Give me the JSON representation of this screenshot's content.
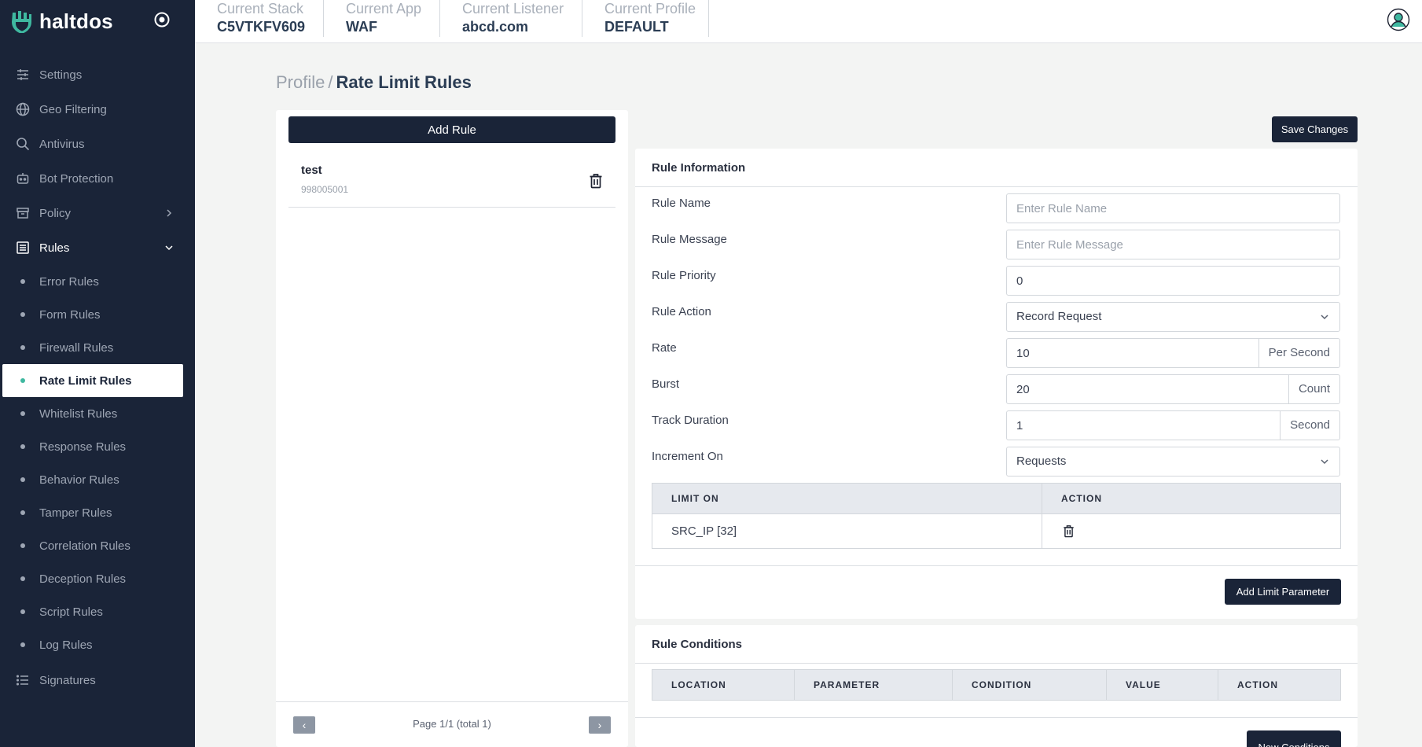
{
  "app": {
    "brand": "haltdos"
  },
  "sidebar": {
    "items": [
      {
        "label": "Settings",
        "icon": "sliders-icon"
      },
      {
        "label": "Geo Filtering",
        "icon": "globe-icon"
      },
      {
        "label": "Antivirus",
        "icon": "search-icon"
      },
      {
        "label": "Bot Protection",
        "icon": "robot-icon"
      },
      {
        "label": "Policy",
        "icon": "archive-icon"
      },
      {
        "label": "Rules",
        "icon": "list-icon"
      }
    ],
    "rules_sub": [
      "Error Rules",
      "Form Rules",
      "Firewall Rules",
      "Rate Limit Rules",
      "Whitelist Rules",
      "Response Rules",
      "Behavior Rules",
      "Tamper Rules",
      "Correlation Rules",
      "Deception Rules",
      "Script Rules",
      "Log Rules"
    ],
    "signatures": "Signatures",
    "active_sub": "Rate Limit Rules",
    "colors": {
      "background": "#1a2438",
      "active_dot": "#3fb8a0"
    }
  },
  "topbar": {
    "stack_label": "Current Stack",
    "stack_value": "C5VTKFV609",
    "app_label": "Current App",
    "app_value": "WAF",
    "listener_label": "Current Listener",
    "listener_value": "abcd.com",
    "profile_label": "Current Profile",
    "profile_value": "DEFAULT"
  },
  "breadcrumb": {
    "root": "Profile",
    "sep": "/",
    "current": "Rate Limit Rules"
  },
  "rule_list": {
    "add_label": "Add Rule",
    "items": [
      {
        "name": "test",
        "id": "998005001"
      }
    ],
    "pager": {
      "prev": "‹",
      "next": "›",
      "text": "Page 1/1 (total 1)"
    }
  },
  "save_label": "Save Changes",
  "rule_info": {
    "title": "Rule Information",
    "name_label": "Rule Name",
    "name_placeholder": "Enter Rule Name",
    "message_label": "Rule Message",
    "message_placeholder": "Enter Rule Message",
    "priority_label": "Rule Priority",
    "priority_value": "0",
    "action_label": "Rule Action",
    "action_value": "Record Request",
    "rate_label": "Rate",
    "rate_value": "10",
    "rate_unit": "Per Second",
    "burst_label": "Burst",
    "burst_value": "20",
    "burst_unit": "Count",
    "track_label": "Track Duration",
    "track_value": "1",
    "track_unit": "Second",
    "increment_label": "Increment On",
    "increment_value": "Requests",
    "limit_table": {
      "headers": [
        "LIMIT ON",
        "ACTION"
      ],
      "rows": [
        {
          "limit_on": "SRC_IP [32]"
        }
      ]
    },
    "add_limit_label": "Add Limit Parameter"
  },
  "rule_conditions": {
    "title": "Rule Conditions",
    "headers": [
      "LOCATION",
      "PARAMETER",
      "CONDITION",
      "VALUE",
      "ACTION"
    ],
    "new_label": "New Conditions"
  }
}
